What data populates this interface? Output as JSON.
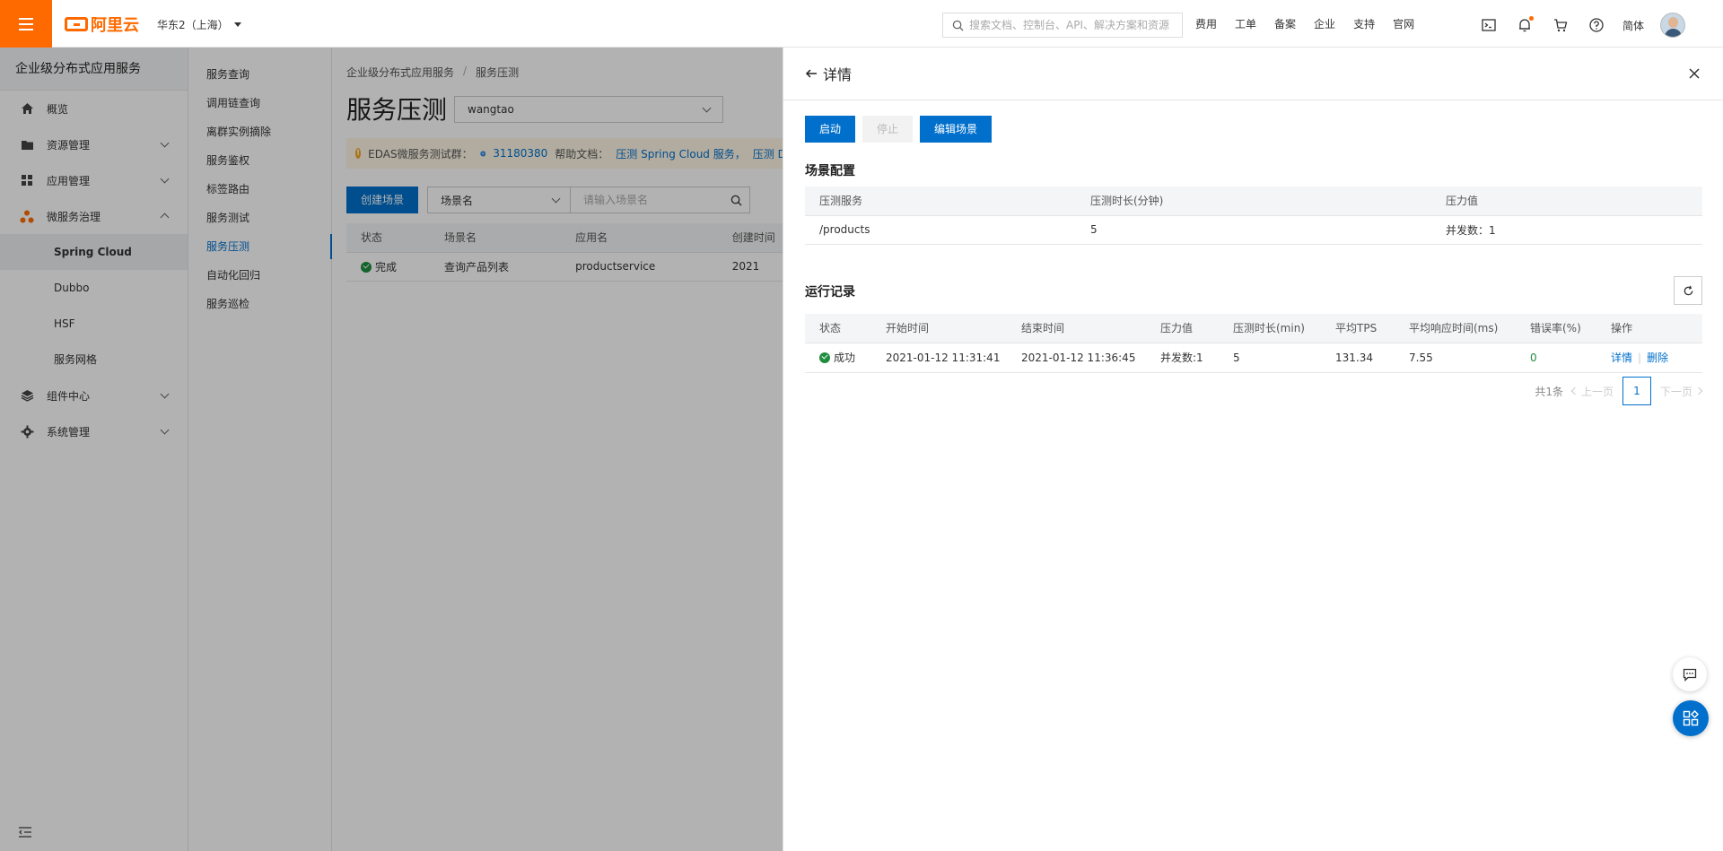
{
  "topbar": {
    "logo_text": "阿里云",
    "region": "华东2（上海）",
    "search_placeholder": "搜索文档、控制台、API、解决方案和资源",
    "links": [
      "费用",
      "工单",
      "备案",
      "企业",
      "支持",
      "官网"
    ],
    "icons": [
      "terminal-icon",
      "bell-icon",
      "cart-icon",
      "help-icon"
    ],
    "language": "简体",
    "brand_color": "#ff6a00"
  },
  "leftnav": {
    "title": "企业级分布式应用服务",
    "items": [
      {
        "label": "概览",
        "icon": "home-icon"
      },
      {
        "label": "资源管理",
        "icon": "folder-icon"
      },
      {
        "label": "应用管理",
        "icon": "apps-icon"
      },
      {
        "label": "微服务治理",
        "icon": "microservice-icon"
      }
    ],
    "subitems": [
      "Spring Cloud",
      "Dubbo",
      "HSF",
      "服务网格"
    ],
    "bottom_items": [
      {
        "label": "组件中心",
        "icon": "layers-icon"
      },
      {
        "label": "系统管理",
        "icon": "gear-icon"
      }
    ]
  },
  "subnav": {
    "items": [
      "服务查询",
      "调用链查询",
      "离群实例摘除",
      "服务鉴权",
      "标签路由",
      "服务测试",
      "服务压测",
      "自动化回归",
      "服务巡检"
    ],
    "active_index": 6
  },
  "main": {
    "breadcrumb": [
      "企业级分布式应用服务",
      "服务压测"
    ],
    "title": "服务压测",
    "namespace": "wangtao",
    "notice": {
      "prefix": "EDAS微服务测试群：",
      "group": "31180380",
      "docs_label": "帮助文档：",
      "doc1": "压测 Spring Cloud 服务，",
      "doc2": "压测 Dubbo"
    },
    "create_button": "创建场景",
    "filter_select": "场景名",
    "filter_placeholder": "请输入场景名",
    "table": {
      "headers": [
        "状态",
        "场景名",
        "应用名",
        "创建时间"
      ],
      "rows": [
        [
          "完成",
          "查询产品列表",
          "productservice",
          "2021"
        ]
      ]
    }
  },
  "drawer": {
    "title": "详情",
    "actions": [
      "启动",
      "停止",
      "编辑场景"
    ],
    "config_title": "场景配置",
    "config_headers": [
      "压测服务",
      "压测时长(分钟)",
      "压力值"
    ],
    "config_rows": [
      [
        "/products",
        "5",
        "并发数：1"
      ]
    ],
    "runs_title": "运行记录",
    "run_headers": [
      "状态",
      "开始时间",
      "结束时间",
      "压力值",
      "压测时长(min)",
      "平均TPS",
      "平均响应时间(ms)",
      "错误率(%)",
      "操作"
    ],
    "run_rows": [
      {
        "status": "成功",
        "start": "2021-01-12 11:31:41",
        "end": "2021-01-12 11:36:45",
        "pressure": "并发数:1",
        "duration": "5",
        "tps": "131.34",
        "rt": "7.55",
        "error": "0",
        "op_detail": "详情",
        "op_delete": "删除"
      }
    ],
    "pager": {
      "total": "共1条",
      "prev": "上一页",
      "current": "1",
      "next": "下一页"
    }
  },
  "accent_color": "#0070cc"
}
